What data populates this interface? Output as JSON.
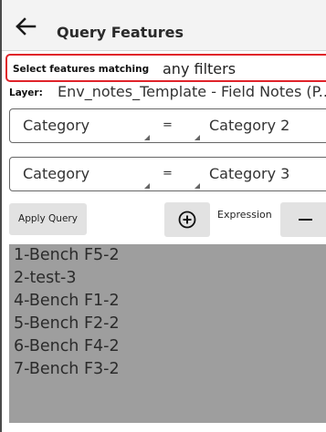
{
  "header": {
    "title": "Query Features",
    "back_icon": "arrow-left-icon"
  },
  "filter_mode": {
    "label": "Select features matching",
    "value": "any filters"
  },
  "layer": {
    "label": "Layer:",
    "value": "Env_notes_Template - Field Notes (P..."
  },
  "expressions": [
    {
      "field": "Category",
      "operator": "=",
      "value": "Category 2"
    },
    {
      "field": "Category",
      "operator": "=",
      "value": "Category 3"
    }
  ],
  "actions": {
    "apply_label": "Apply Query",
    "add_icon": "plus-circle-icon",
    "expression_label": "Expression",
    "remove_icon": "minus-icon"
  },
  "results": [
    "1-Bench F5-2",
    "2-test-3",
    "4-Bench F1-2",
    "5-Bench F2-2",
    "6-Bench F4-2",
    "7-Bench F3-2"
  ],
  "colors": {
    "highlight": "#e0232a",
    "result_background": "#9e9e9e",
    "button": "#e2e2e2"
  }
}
